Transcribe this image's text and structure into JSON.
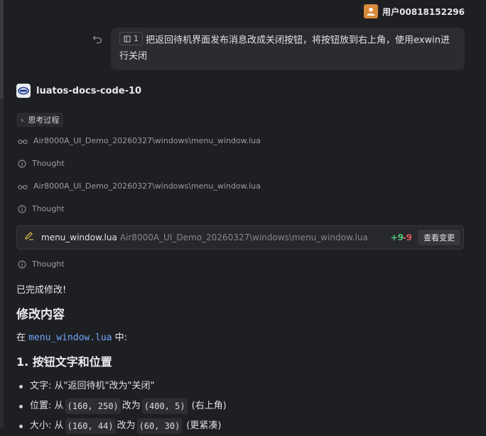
{
  "user": {
    "name": "用户00818152296"
  },
  "message": {
    "file_ref": "1",
    "text": "把返回待机界面发布消息改成关闭按钮，将按钮放到右上角，使用exwin进行关闭"
  },
  "assistant": {
    "name": "luatos-docs-code-10"
  },
  "thinking": {
    "label": "思考过程"
  },
  "steps": [
    {
      "type": "read",
      "text": "Air8000A_UI_Demo_20260327\\windows\\menu_window.lua"
    },
    {
      "type": "thought",
      "text": "Thought"
    },
    {
      "type": "read",
      "text": "Air8000A_UI_Demo_20260327\\windows\\menu_window.lua"
    },
    {
      "type": "thought",
      "text": "Thought"
    }
  ],
  "edit": {
    "file_name": "menu_window.lua",
    "file_path": "Air8000A_UI_Demo_20260327\\windows\\menu_window.lua",
    "additions": "+9",
    "deletions": "-9",
    "view_label": "查看变更"
  },
  "thought_after": "Thought",
  "response": {
    "done": "已完成修改!",
    "heading": "修改内容",
    "in_prefix": "在 ",
    "file_code": "menu_window.lua",
    "in_suffix": " 中:",
    "subheading": "1. 按钮文字和位置",
    "bullets": [
      {
        "label": "文字: 从\"返回待机\"改为\"关闭\""
      },
      {
        "label": "位置: 从",
        "code1": "(160, 250)",
        "mid": "改为",
        "code2": "(400, 5)",
        "tail": "(右上角)"
      },
      {
        "label": "大小: 从",
        "code1": "(160, 44)",
        "mid": "改为",
        "code2": "(60, 30)",
        "tail": "(更紧凑)"
      }
    ]
  }
}
